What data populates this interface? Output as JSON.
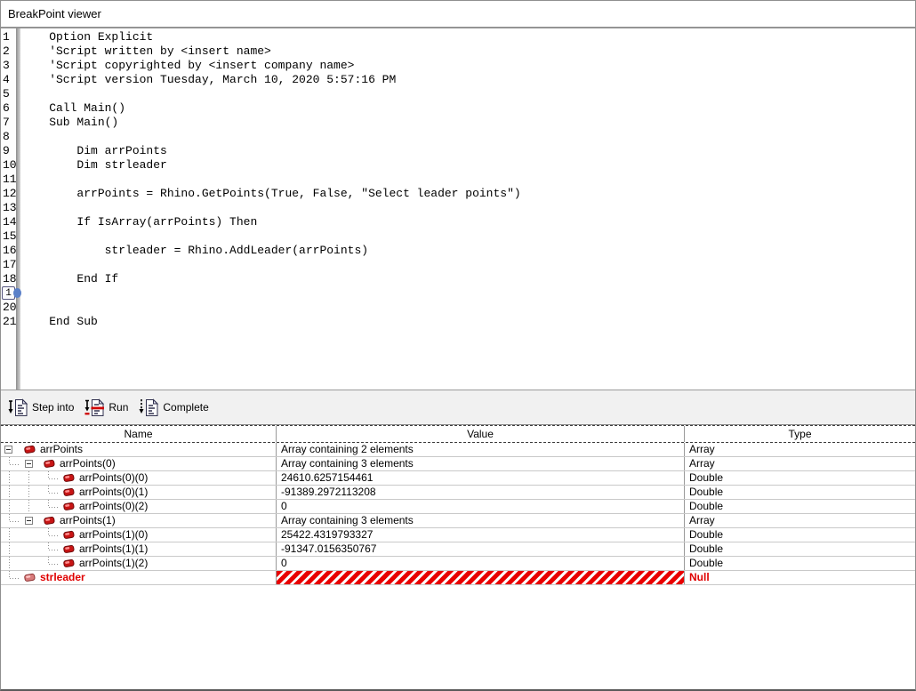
{
  "window": {
    "title": "BreakPoint viewer"
  },
  "code": {
    "lines": [
      {
        "num": "1",
        "text": "    Option Explicit"
      },
      {
        "num": "2",
        "text": "    'Script written by <insert name>"
      },
      {
        "num": "3",
        "text": "    'Script copyrighted by <insert company name>"
      },
      {
        "num": "4",
        "text": "    'Script version Tuesday, March 10, 2020 5:57:16 PM"
      },
      {
        "num": "5",
        "text": ""
      },
      {
        "num": "6",
        "text": "    Call Main()"
      },
      {
        "num": "7",
        "text": "    Sub Main()"
      },
      {
        "num": "8",
        "text": ""
      },
      {
        "num": "9",
        "text": "        Dim arrPoints"
      },
      {
        "num": "10",
        "text": "        Dim strleader"
      },
      {
        "num": "11",
        "text": ""
      },
      {
        "num": "12",
        "text": "        arrPoints = Rhino.GetPoints(True, False, \"Select leader points\")"
      },
      {
        "num": "13",
        "text": ""
      },
      {
        "num": "14",
        "text": "        If IsArray(arrPoints) Then"
      },
      {
        "num": "15",
        "text": ""
      },
      {
        "num": "16",
        "text": "            strleader = Rhino.AddLeader(arrPoints)"
      },
      {
        "num": "17",
        "text": ""
      },
      {
        "num": "18",
        "text": "        End If"
      },
      {
        "num": "19",
        "text": ""
      },
      {
        "num": "20",
        "text": ""
      },
      {
        "num": "21",
        "text": "    End Sub"
      }
    ],
    "current_line_marker": {
      "visible_text": "1"
    }
  },
  "toolbar": {
    "buttons": [
      {
        "label": "Step into",
        "icon": "step-into-icon"
      },
      {
        "label": "Run",
        "icon": "run-icon"
      },
      {
        "label": "Complete",
        "icon": "complete-icon"
      }
    ]
  },
  "table": {
    "columns": [
      "Name",
      "Value",
      "Type"
    ],
    "rows": [
      {
        "name": "arrPoints",
        "value": "Array containing 2 elements",
        "type": "Array"
      },
      {
        "name": "arrPoints(0)",
        "value": "Array containing 3 elements",
        "type": "Array"
      },
      {
        "name": "arrPoints(0)(0)",
        "value": "24610.6257154461",
        "type": "Double"
      },
      {
        "name": "arrPoints(0)(1)",
        "value": "-91389.2972113208",
        "type": "Double"
      },
      {
        "name": "arrPoints(0)(2)",
        "value": "0",
        "type": "Double"
      },
      {
        "name": "arrPoints(1)",
        "value": "Array containing 3 elements",
        "type": "Array"
      },
      {
        "name": "arrPoints(1)(0)",
        "value": "25422.4319793327",
        "type": "Double"
      },
      {
        "name": "arrPoints(1)(1)",
        "value": "-91347.0156350767",
        "type": "Double"
      },
      {
        "name": "arrPoints(1)(2)",
        "value": "0",
        "type": "Double"
      },
      {
        "name": "strleader",
        "value": "",
        "type": "Null"
      }
    ]
  },
  "colors": {
    "error_red": "#e00000",
    "hatch_red": "#e80000",
    "marker_blue": "#5b80c8",
    "toolbar_bg": "#f1f1f1"
  }
}
